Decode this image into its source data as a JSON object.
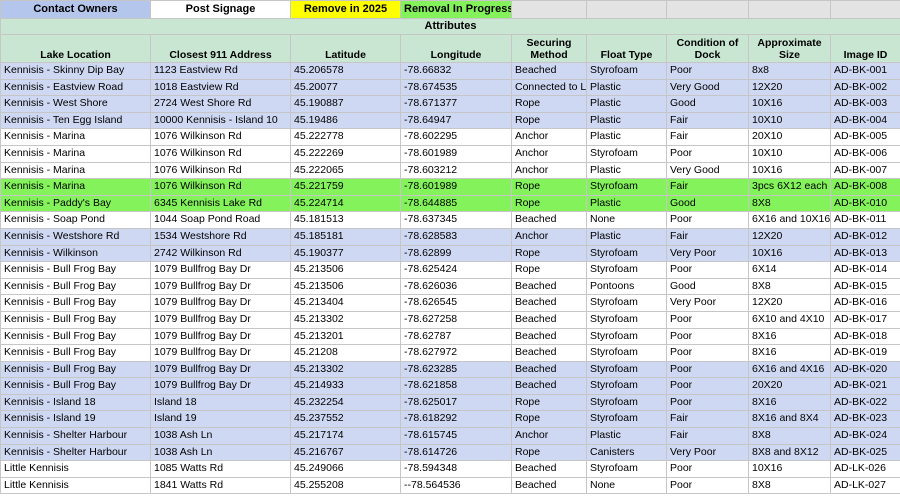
{
  "legend": {
    "contact_owners": "Contact Owners",
    "post_signage": "Post Signage",
    "remove_2025": "Remove in 2025",
    "removal_in_progress": "Removal In Progress"
  },
  "colors": {
    "contact_owners": "#b4c6ec",
    "remove_2025": "#ffff00",
    "removal_in_progress": "#83f25b",
    "header_bg": "#c9e6d3",
    "row_blue": "#cfd8f2",
    "row_green": "#83f25b"
  },
  "section_title": "Attributes",
  "headers": {
    "location": "Lake Location",
    "address": "Closest 911 Address",
    "lat": "Latitude",
    "lon": "Longitude",
    "secure": "Securing Method",
    "float": "Float Type",
    "cond": "Condition of Dock",
    "size": "Approximate Size",
    "id": "Image ID"
  },
  "rows": [
    {
      "hl": "blue",
      "location": "Kennisis - Skinny Dip Bay",
      "address": "1123 Eastview Rd",
      "lat": "45.206578",
      "lon": "-78.66832",
      "secure": "Beached",
      "float": "Styrofoam",
      "cond": "Poor",
      "size": "8x8",
      "id": "AD-BK-001"
    },
    {
      "hl": "blue",
      "location": "Kennisis - Eastview Road",
      "address": "1018 Eastview Rd",
      "lat": "45.20077",
      "lon": "-78.674535",
      "secure": "Connected to L",
      "float": "Plastic",
      "cond": "Very Good",
      "size": "12X20",
      "id": "AD-BK-002"
    },
    {
      "hl": "blue",
      "location": "Kennisis - West Shore",
      "address": "2724 West Shore Rd",
      "lat": "45.190887",
      "lon": "-78.671377",
      "secure": "Rope",
      "float": "Plastic",
      "cond": "Good",
      "size": "10X16",
      "id": "AD-BK-003"
    },
    {
      "hl": "blue",
      "location": "Kennisis - Ten Egg Island",
      "address": "10000 Kennisis - Island 10",
      "lat": "45.19486",
      "lon": "-78.64947",
      "secure": "Rope",
      "float": "Plastic",
      "cond": "Fair",
      "size": "10X10",
      "id": "AD-BK-004"
    },
    {
      "hl": "white",
      "location": "Kennisis - Marina",
      "address": "1076 Wilkinson Rd",
      "lat": "45.222778",
      "lon": "-78.602295",
      "secure": "Anchor",
      "float": "Plastic",
      "cond": "Fair",
      "size": "20X10",
      "id": "AD-BK-005"
    },
    {
      "hl": "white",
      "location": "Kennisis - Marina",
      "address": "1076 Wilkinson Rd",
      "lat": "45.222269",
      "lon": "-78.601989",
      "secure": "Anchor",
      "float": "Styrofoam",
      "cond": "Poor",
      "size": "10X10",
      "id": "AD-BK-006"
    },
    {
      "hl": "white",
      "location": "Kennisis - Marina",
      "address": "1076 Wilkinson Rd",
      "lat": "45.222065",
      "lon": "-78.603212",
      "secure": "Anchor",
      "float": "Plastic",
      "cond": "Very Good",
      "size": "10X16",
      "id": "AD-BK-007"
    },
    {
      "hl": "green",
      "location": "Kennisis - Marina",
      "address": "1076 Wilkinson Rd",
      "lat": "45.221759",
      "lon": "-78.601989",
      "secure": "Rope",
      "float": "Styrofoam",
      "cond": "Fair",
      "size": "3pcs 6X12 each",
      "id": "AD-BK-008"
    },
    {
      "hl": "green",
      "location": "Kennisis - Paddy's Bay",
      "address": "6345 Kennisis Lake Rd",
      "lat": "45.224714",
      "lon": "-78.644885",
      "secure": "Rope",
      "float": "Plastic",
      "cond": "Good",
      "size": "8X8",
      "id": "AD-BK-010"
    },
    {
      "hl": "white",
      "location": "Kennisis - Soap Pond",
      "address": "1044 Soap Pond Road",
      "lat": "45.181513",
      "lon": "-78.637345",
      "secure": "Beached",
      "float": "None",
      "cond": "Poor",
      "size": "6X16 and 10X16",
      "id": "AD-BK-011"
    },
    {
      "hl": "blue",
      "location": "Kennisis - Westshore Rd",
      "address": "1534 Westshore Rd",
      "lat": "45.185181",
      "lon": "-78.628583",
      "secure": "Anchor",
      "float": "Plastic",
      "cond": "Fair",
      "size": "12X20",
      "id": "AD-BK-012"
    },
    {
      "hl": "blue",
      "location": "Kennisis - Wilkinson",
      "address": "2742 Wilkinson Rd",
      "lat": "45.190377",
      "lon": "-78.62899",
      "secure": "Rope",
      "float": "Styrofoam",
      "cond": "Very Poor",
      "size": "10X16",
      "id": "AD-BK-013"
    },
    {
      "hl": "white",
      "location": "Kennisis - Bull Frog Bay",
      "address": "1079 Bullfrog Bay Dr",
      "lat": "45.213506",
      "lon": "-78.625424",
      "secure": "Rope",
      "float": "Styrofoam",
      "cond": "Poor",
      "size": "6X14",
      "id": "AD-BK-014"
    },
    {
      "hl": "white",
      "location": "Kennisis - Bull Frog Bay",
      "address": "1079 Bullfrog Bay Dr",
      "lat": "45.213506",
      "lon": "-78.626036",
      "secure": "Beached",
      "float": "Pontoons",
      "cond": "Good",
      "size": "8X8",
      "id": "AD-BK-015"
    },
    {
      "hl": "white",
      "location": "Kennisis - Bull Frog Bay",
      "address": "1079 Bullfrog Bay Dr",
      "lat": "45.213404",
      "lon": "-78.626545",
      "secure": "Beached",
      "float": "Styrofoam",
      "cond": "Very Poor",
      "size": "12X20",
      "id": "AD-BK-016"
    },
    {
      "hl": "white",
      "location": "Kennisis - Bull Frog Bay",
      "address": "1079 Bullfrog Bay Dr",
      "lat": "45.213302",
      "lon": "-78.627258",
      "secure": "Beached",
      "float": "Styrofoam",
      "cond": "Poor",
      "size": "6X10 and 4X10",
      "id": "AD-BK-017"
    },
    {
      "hl": "white",
      "location": "Kennisis - Bull Frog Bay",
      "address": "1079 Bullfrog Bay Dr",
      "lat": "45.213201",
      "lon": "-78.62787",
      "secure": "Beached",
      "float": "Styrofoam",
      "cond": "Poor",
      "size": "8X16",
      "id": "AD-BK-018"
    },
    {
      "hl": "white",
      "location": "Kennisis - Bull Frog Bay",
      "address": "1079 Bullfrog Bay Dr",
      "lat": "45.21208",
      "lon": "-78.627972",
      "secure": "Beached",
      "float": "Styrofoam",
      "cond": "Poor",
      "size": "8X16",
      "id": "AD-BK-019"
    },
    {
      "hl": "blue",
      "location": "Kennisis - Bull Frog Bay",
      "address": "1079 Bullfrog Bay Dr",
      "lat": "45.213302",
      "lon": "-78.623285",
      "secure": "Beached",
      "float": "Styrofoam",
      "cond": "Poor",
      "size": "6X16 and 4X16",
      "id": "AD-BK-020"
    },
    {
      "hl": "blue",
      "location": "Kennisis - Bull Frog Bay",
      "address": "1079 Bullfrog Bay Dr",
      "lat": "45.214933",
      "lon": "-78.621858",
      "secure": "Beached",
      "float": "Styrofoam",
      "cond": "Poor",
      "size": "20X20",
      "id": "AD-BK-021"
    },
    {
      "hl": "blue",
      "location": "Kennisis - Island 18",
      "address": "Island 18",
      "lat": "45.232254",
      "lon": "-78.625017",
      "secure": "Rope",
      "float": "Styrofoam",
      "cond": "Poor",
      "size": "8X16",
      "id": "AD-BK-022"
    },
    {
      "hl": "blue",
      "location": "Kennisis - Island 19",
      "address": "Island 19",
      "lat": "45.237552",
      "lon": "-78.618292",
      "secure": "Rope",
      "float": "Styrofoam",
      "cond": "Fair",
      "size": "8X16 and 8X4",
      "id": "AD-BK-023"
    },
    {
      "hl": "blue",
      "location": "Kennisis - Shelter Harbour",
      "address": "1038 Ash Ln",
      "lat": "45.217174",
      "lon": "-78.615745",
      "secure": "Anchor",
      "float": "Plastic",
      "cond": "Fair",
      "size": "8X8",
      "id": "AD-BK-024"
    },
    {
      "hl": "blue",
      "location": "Kennisis - Shelter Harbour",
      "address": "1038 Ash Ln",
      "lat": "45.216767",
      "lon": "-78.614726",
      "secure": "Rope",
      "float": "Canisters",
      "cond": "Very Poor",
      "size": "8X8 and 8X12",
      "id": "AD-BK-025"
    },
    {
      "hl": "white",
      "location": "Little Kennisis",
      "address": "1085 Watts Rd",
      "lat": "45.249066",
      "lon": "-78.594348",
      "secure": "Beached",
      "float": "Styrofoam",
      "cond": "Poor",
      "size": "10X16",
      "id": "AD-LK-026"
    },
    {
      "hl": "white",
      "location": "Little Kennisis",
      "address": "1841 Watts Rd",
      "lat": "45.255208",
      "lon": "--78.564536",
      "secure": "Beached",
      "float": "None",
      "cond": "Poor",
      "size": "8X8",
      "id": "AD-LK-027"
    }
  ]
}
